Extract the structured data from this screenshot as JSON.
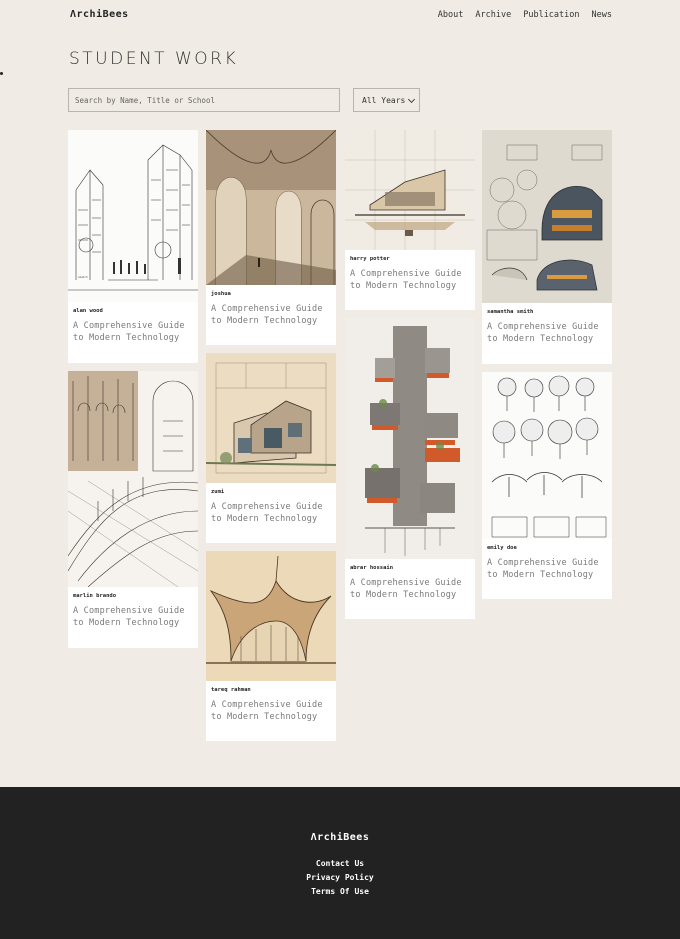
{
  "header": {
    "logo": "ΛrchiBees",
    "nav": [
      "About",
      "Archive",
      "Publication",
      "News"
    ]
  },
  "page_title": "STUDENT WORK",
  "search": {
    "placeholder": "Search by Name, Title or School",
    "value": ""
  },
  "year_filter": {
    "selected": "All Years"
  },
  "cards": [
    {
      "author": "alan wood",
      "title": "A Comprehensive Guide to Modern Technology"
    },
    {
      "author": "marlin brando",
      "title": "A Comprehensive Guide to Modern Technology"
    },
    {
      "author": "joshua",
      "title": "A Comprehensive Guide to Modern Technology"
    },
    {
      "author": "zumi",
      "title": "A Comprehensive Guide to Modern Technology"
    },
    {
      "author": "tareq rahman",
      "title": "A Comprehensive Guide to Modern Technology"
    },
    {
      "author": "harry potter",
      "title": "A Comprehensive Guide to Modern Technology"
    },
    {
      "author": "abrar hossain",
      "title": "A Comprehensive Guide to Modern Technology"
    },
    {
      "author": "samantha smith",
      "title": "A Comprehensive Guide to Modern Technology"
    },
    {
      "author": "emily doe",
      "title": "A Comprehensive Guide to Modern Technology"
    }
  ],
  "footer": {
    "logo": "ΛrchiBees",
    "links": [
      "Contact Us",
      "Privacy Policy",
      "Terms Of Use"
    ]
  }
}
